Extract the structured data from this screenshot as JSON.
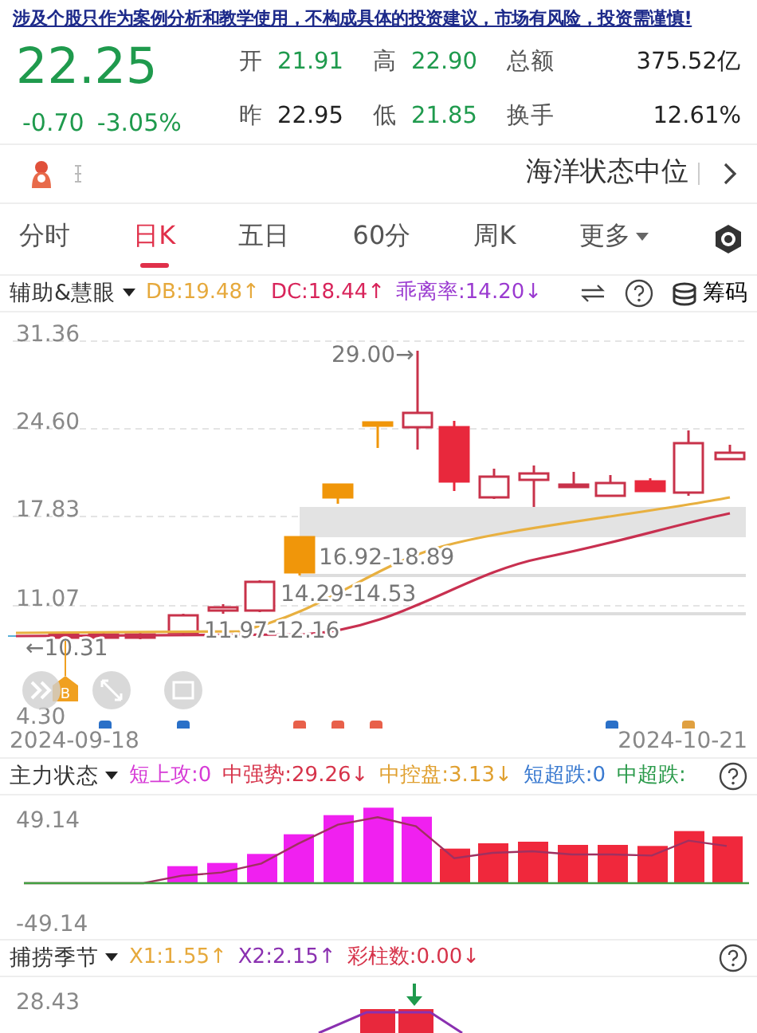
{
  "disclaimer": "涉及个股只作为案例分析和教学使用，不构成具体的投资建议，市场有风险，投资需谨慎!",
  "quote": {
    "price": "22.25",
    "change": "-0.70",
    "change_pct": "-3.05%",
    "color": "#1f9a4d"
  },
  "stats": [
    {
      "label": "开",
      "value": "21.91",
      "color": "#1f9a4d"
    },
    {
      "label": "高",
      "value": "22.90",
      "color": "#1f9a4d"
    },
    {
      "label": "总额",
      "value": "375.52亿",
      "color": "#222222"
    },
    {
      "label": "昨",
      "value": "22.95",
      "color": "#222222"
    },
    {
      "label": "低",
      "value": "21.85",
      "color": "#1f9a4d"
    },
    {
      "label": "换手",
      "value": "12.61%",
      "color": "#222222"
    }
  ],
  "status_row": {
    "text": "海洋状态中位"
  },
  "tabs": [
    {
      "label": "分时",
      "selected": false,
      "dropdown": false
    },
    {
      "label": "日K",
      "selected": true,
      "dropdown": false
    },
    {
      "label": "五日",
      "selected": false,
      "dropdown": false
    },
    {
      "label": "60分",
      "selected": false,
      "dropdown": false
    },
    {
      "label": "周K",
      "selected": false,
      "dropdown": false
    },
    {
      "label": "更多",
      "selected": false,
      "dropdown": true
    }
  ],
  "main_indicator": {
    "name": "辅助&慧眼",
    "values": [
      {
        "text": "DB:19.48↑",
        "color": "#e6a93c"
      },
      {
        "text": "DC:18.44↑",
        "color": "#d8245a"
      },
      {
        "text": "乖离率:14.20↓",
        "color": "#9a3ad0"
      }
    ],
    "chip_label": "筹码"
  },
  "main_chart": {
    "y_labels": [
      "31.36",
      "24.60",
      "17.83",
      "11.07",
      "4.30"
    ],
    "annotations": [
      "29.00→",
      "16.92-18.89",
      "14.29-14.53",
      "11.97-12.16",
      "←10.31"
    ],
    "buy_marker": "B",
    "dates": [
      "2024-09-18",
      "2024-10-21"
    ]
  },
  "sub_indicator": {
    "name": "主力状态",
    "values": [
      {
        "text": "短上攻:0",
        "color": "#d63bd6"
      },
      {
        "text": "中强势:29.26↓",
        "color": "#d6334a"
      },
      {
        "text": "中控盘:3.13↓",
        "color": "#e0a030"
      },
      {
        "text": "短超跌:0",
        "color": "#3a7ad0"
      },
      {
        "text": "中超跌:",
        "color": "#2a9a4a"
      }
    ],
    "y_labels": [
      "49.14",
      "-49.14"
    ]
  },
  "third_indicator": {
    "name": "捕捞季节",
    "values": [
      {
        "text": "X1:1.55↑",
        "color": "#e6a93c"
      },
      {
        "text": "X2:2.15↑",
        "color": "#8a30b0"
      },
      {
        "text": "彩柱数:0.00↓",
        "color": "#d6334a"
      }
    ],
    "y_labels": [
      "28.43"
    ]
  }
}
